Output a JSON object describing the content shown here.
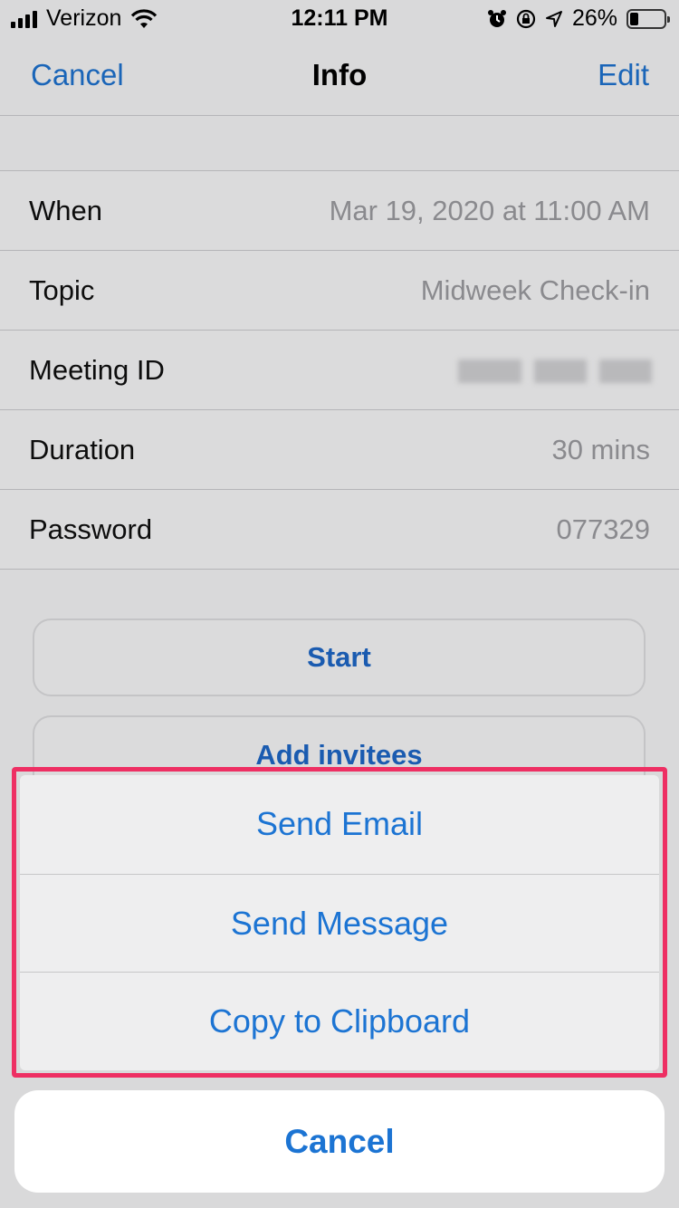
{
  "status_bar": {
    "carrier": "Verizon",
    "time": "12:11 PM",
    "battery": "26%",
    "battery_level": 0.26,
    "icons": [
      "signal-icon",
      "wifi-icon",
      "alarm-icon",
      "orientation-lock-icon",
      "location-icon",
      "battery-icon"
    ]
  },
  "nav": {
    "cancel_label": "Cancel",
    "title": "Info",
    "edit_label": "Edit"
  },
  "info": {
    "rows": [
      {
        "label": "When",
        "value": "Mar 19, 2020 at 11:00 AM"
      },
      {
        "label": "Topic",
        "value": "Midweek Check-in"
      },
      {
        "label": "Meeting ID",
        "value": ""
      },
      {
        "label": "Duration",
        "value": "30 mins"
      },
      {
        "label": "Password",
        "value": "077329"
      }
    ]
  },
  "buttons": {
    "start_label": "Start",
    "add_invitees_label": "Add invitees"
  },
  "action_sheet": {
    "items": [
      {
        "label": "Send Email"
      },
      {
        "label": "Send Message"
      },
      {
        "label": "Copy to Clipboard"
      }
    ],
    "cancel_label": "Cancel"
  },
  "colors": {
    "accent": "#1c74d3",
    "highlight_border": "#ee2f63",
    "dimmed_background": "#d9d9da"
  }
}
